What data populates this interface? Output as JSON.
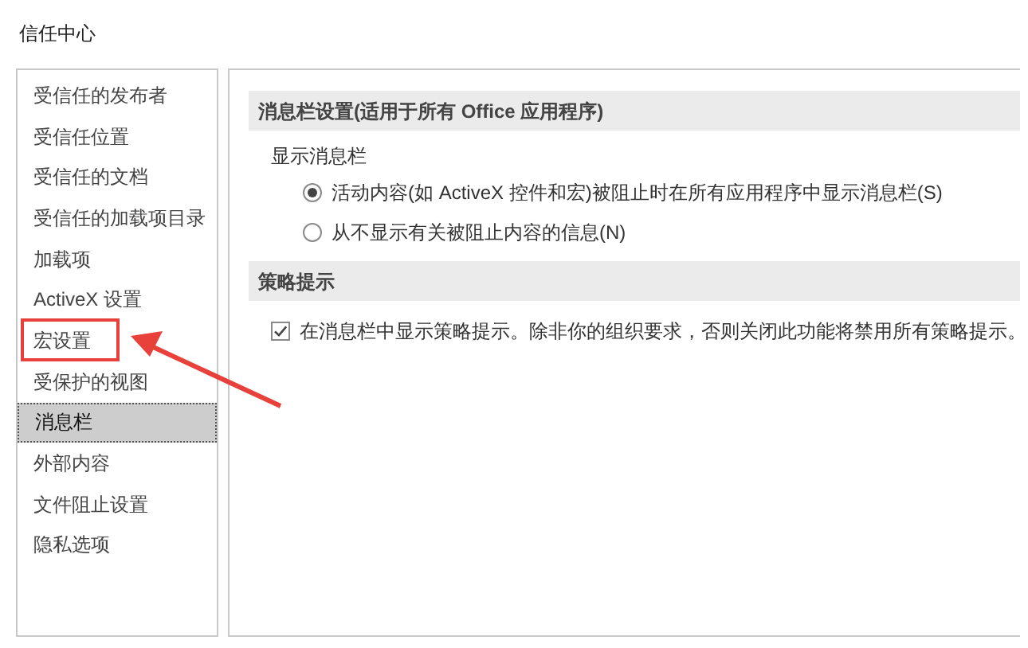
{
  "window": {
    "title": "信任中心"
  },
  "sidebar": {
    "items": [
      {
        "label": "受信任的发布者",
        "selected": false,
        "highlighted": false
      },
      {
        "label": "受信任位置",
        "selected": false,
        "highlighted": false
      },
      {
        "label": "受信任的文档",
        "selected": false,
        "highlighted": false
      },
      {
        "label": "受信任的加载项目录",
        "selected": false,
        "highlighted": false
      },
      {
        "label": "加载项",
        "selected": false,
        "highlighted": false
      },
      {
        "label": "ActiveX 设置",
        "selected": false,
        "highlighted": false
      },
      {
        "label": "宏设置",
        "selected": false,
        "highlighted": true
      },
      {
        "label": "受保护的视图",
        "selected": false,
        "highlighted": false
      },
      {
        "label": "消息栏",
        "selected": true,
        "highlighted": false
      },
      {
        "label": "外部内容",
        "selected": false,
        "highlighted": false
      },
      {
        "label": "文件阻止设置",
        "selected": false,
        "highlighted": false
      },
      {
        "label": "隐私选项",
        "selected": false,
        "highlighted": false
      }
    ]
  },
  "sections": [
    {
      "title": "消息栏设置(适用于所有 Office 应用程序)",
      "group_label": "显示消息栏",
      "options": [
        {
          "kind": "radio",
          "label": "活动内容(如 ActiveX 控件和宏)被阻止时在所有应用程序中显示消息栏(S)",
          "selected": true
        },
        {
          "kind": "radio",
          "label": "从不显示有关被阻止内容的信息(N)",
          "selected": false
        }
      ]
    },
    {
      "title": "策略提示",
      "options": [
        {
          "kind": "checkbox",
          "label": "在消息栏中显示策略提示。除非你的组织要求，否则关闭此功能将禁用所有策略提示。",
          "checked": true
        }
      ]
    }
  ]
}
